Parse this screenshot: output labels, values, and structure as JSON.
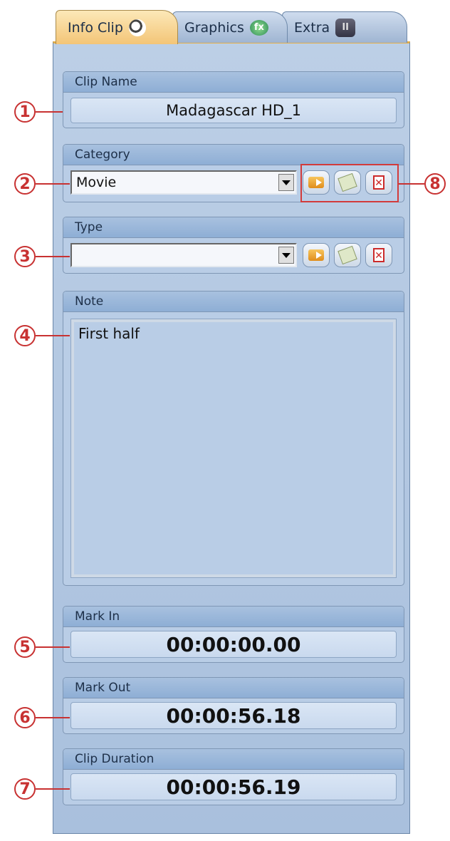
{
  "tabs": [
    {
      "label": "Info Clip",
      "icon": "soccer-ball-icon"
    },
    {
      "label": "Graphics",
      "icon": "fx-icon",
      "icon_text": "fx"
    },
    {
      "label": "Extra",
      "icon": "extra-icon",
      "icon_text": "II"
    }
  ],
  "clip_name": {
    "label": "Clip Name",
    "value": "Madagascar HD_1"
  },
  "category": {
    "label": "Category",
    "value": "Movie"
  },
  "type": {
    "label": "Type",
    "value": ""
  },
  "note": {
    "label": "Note",
    "value": "First half"
  },
  "mark_in": {
    "label": "Mark In",
    "value": "00:00:00.00"
  },
  "mark_out": {
    "label": "Mark Out",
    "value": "00:00:56.18"
  },
  "clip_duration": {
    "label": "Clip Duration",
    "value": "00:00:56.19"
  },
  "buttons": {
    "delete_glyph": "✕"
  },
  "callouts": [
    "1",
    "2",
    "3",
    "4",
    "5",
    "6",
    "7",
    "8"
  ],
  "colors": {
    "callout": "#c83232",
    "active_tab": "#f3c577",
    "panel": "#b0c6e2"
  }
}
